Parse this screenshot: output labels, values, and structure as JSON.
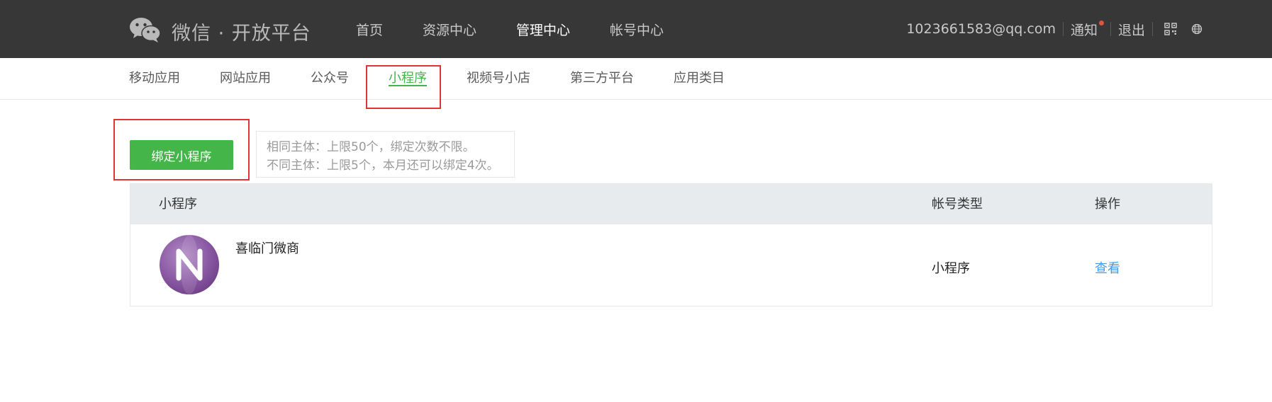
{
  "header": {
    "logo_text": "微信 · 开放平台",
    "nav": [
      {
        "label": "首页",
        "active": false
      },
      {
        "label": "资源中心",
        "active": false
      },
      {
        "label": "管理中心",
        "active": true
      },
      {
        "label": "帐号中心",
        "active": false
      }
    ],
    "account_email": "1023661583@qq.com",
    "notice_label": "通知",
    "logout_label": "退出"
  },
  "subnav": {
    "items": [
      {
        "label": "移动应用",
        "active": false
      },
      {
        "label": "网站应用",
        "active": false
      },
      {
        "label": "公众号",
        "active": false
      },
      {
        "label": "小程序",
        "active": true
      },
      {
        "label": "视频号小店",
        "active": false
      },
      {
        "label": "第三方平台",
        "active": false
      },
      {
        "label": "应用类目",
        "active": false
      }
    ]
  },
  "bind": {
    "button_label": "绑定小程序",
    "tip_line1": "相同主体：上限50个，绑定次数不限。",
    "tip_line2": "不同主体：上限5个，本月还可以绑定4次。"
  },
  "table": {
    "columns": {
      "app": "小程序",
      "type": "帐号类型",
      "action": "操作"
    },
    "rows": [
      {
        "name": "喜临门微商",
        "type": "小程序",
        "action": "查看"
      }
    ]
  },
  "colors": {
    "accent_green": "#44b549",
    "link_blue": "#459ae9",
    "topbar_bg": "#373737",
    "annotation_red": "#e23434"
  }
}
